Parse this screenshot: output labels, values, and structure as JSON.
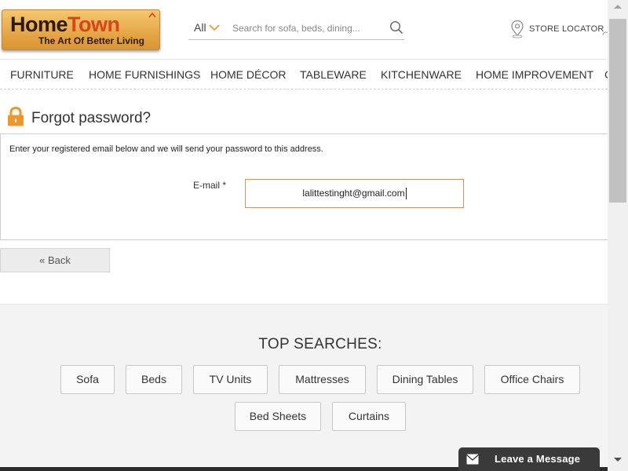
{
  "header": {
    "logo": {
      "name": "HomeTown",
      "name_part1": "Home",
      "name_part2": "Town",
      "tagline": "The Art Of Better Living"
    },
    "search": {
      "category": "All",
      "placeholder": "Search for sofa, beds, dining..."
    },
    "store_locator": "STORE LOCATOR"
  },
  "nav": {
    "items": [
      {
        "label": "FURNITURE"
      },
      {
        "label": "HOME FURNISHINGS"
      },
      {
        "label": "HOME DÉCOR"
      },
      {
        "label": "TABLEWARE"
      },
      {
        "label": "KITCHENWARE"
      },
      {
        "label": "HOME IMPROVEMENT"
      },
      {
        "label": "C"
      }
    ]
  },
  "forgot_password": {
    "title": "Forgot password?",
    "description": "Enter your registered email below and we will send your password to this address.",
    "email_label": "E-mail *",
    "email_value": "lalittestinght@gmail.com",
    "back_label": "« Back"
  },
  "top_searches": {
    "title": "TOP SEARCHES:",
    "items": [
      "Sofa",
      "Beds",
      "TV Units",
      "Mattresses",
      "Dining Tables",
      "Office Chairs",
      "Bed Sheets",
      "Curtains"
    ]
  },
  "chat": {
    "label": "Leave a Message"
  },
  "colors": {
    "accent": "#f0972c",
    "logo_red": "#d8451b",
    "chat_bg": "#3a3a3a",
    "input_border": "#c9946a"
  },
  "icons": [
    "chevron-down-icon",
    "search-icon",
    "location-pin-icon",
    "user-icon",
    "lock-icon",
    "mail-icon"
  ]
}
